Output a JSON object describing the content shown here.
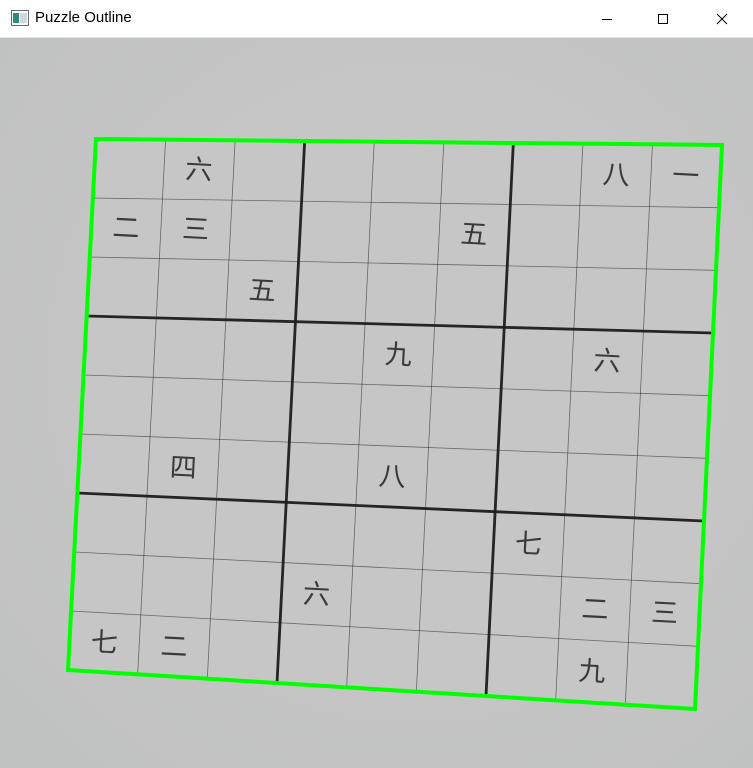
{
  "window": {
    "title": "Puzzle Outline",
    "icons": {
      "app": "window-app-icon",
      "minimize": "minimize-icon",
      "maximize": "maximize-icon",
      "close": "close-icon"
    }
  },
  "puzzle": {
    "outline_color": "#00ff00",
    "grid_color": "#1c1c1c",
    "paper_color": "#c9c9c9",
    "grid_size": 9,
    "digits": [
      {
        "row": 0,
        "col": 1,
        "text": "六"
      },
      {
        "row": 0,
        "col": 7,
        "text": "八"
      },
      {
        "row": 0,
        "col": 8,
        "text": "一"
      },
      {
        "row": 1,
        "col": 0,
        "text": "二"
      },
      {
        "row": 1,
        "col": 1,
        "text": "三"
      },
      {
        "row": 1,
        "col": 5,
        "text": "五"
      },
      {
        "row": 2,
        "col": 2,
        "text": "五"
      },
      {
        "row": 3,
        "col": 4,
        "text": "九"
      },
      {
        "row": 3,
        "col": 7,
        "text": "六"
      },
      {
        "row": 5,
        "col": 1,
        "text": "四"
      },
      {
        "row": 5,
        "col": 4,
        "text": "八"
      },
      {
        "row": 6,
        "col": 6,
        "text": "七"
      },
      {
        "row": 7,
        "col": 3,
        "text": "六"
      },
      {
        "row": 7,
        "col": 7,
        "text": "二"
      },
      {
        "row": 7,
        "col": 8,
        "text": "三"
      },
      {
        "row": 8,
        "col": 0,
        "text": "七"
      },
      {
        "row": 8,
        "col": 1,
        "text": "二"
      },
      {
        "row": 8,
        "col": 7,
        "text": "九"
      }
    ]
  }
}
